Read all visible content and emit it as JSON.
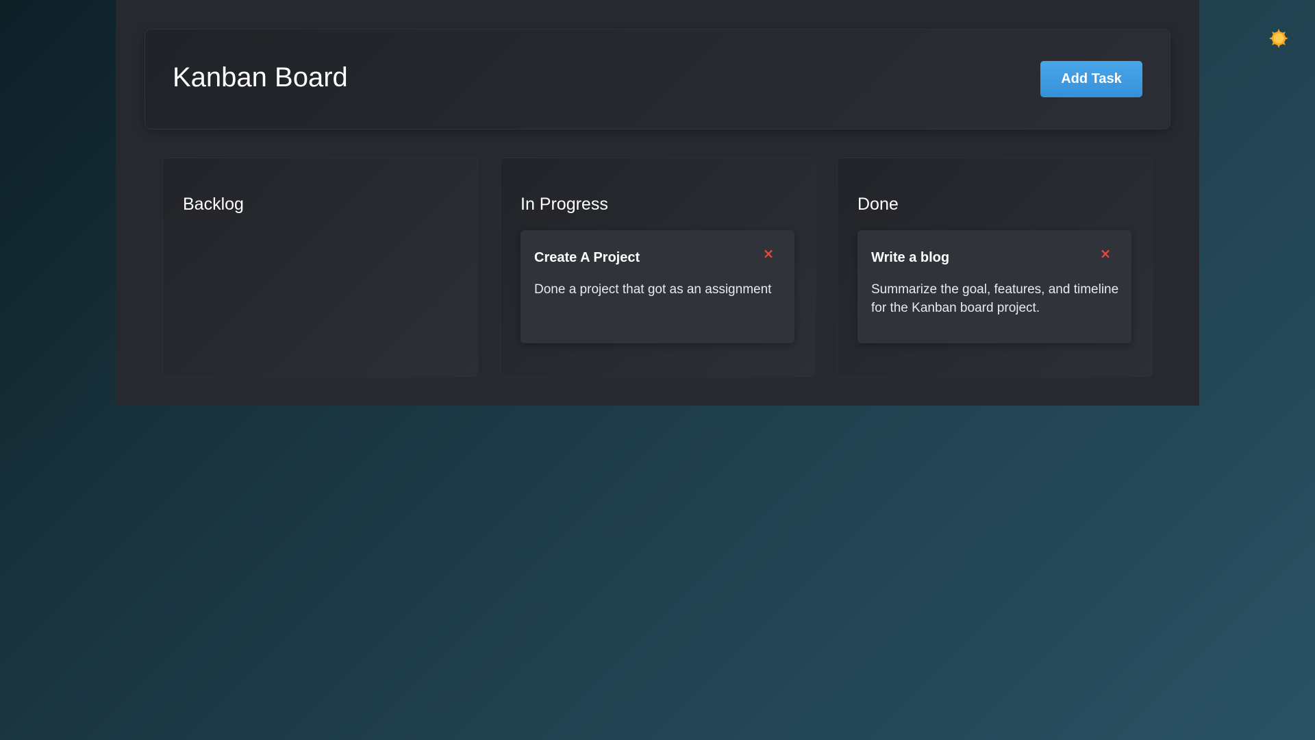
{
  "header": {
    "title": "Kanban Board",
    "add_task_label": "Add Task"
  },
  "theme": {
    "icon": "sun-icon",
    "accent": "#f5a623"
  },
  "colors": {
    "primary_button": "#3d9be0",
    "delete": "#e5453a"
  },
  "columns": [
    {
      "title": "Backlog",
      "tasks": []
    },
    {
      "title": "In Progress",
      "tasks": [
        {
          "title": "Create A Project",
          "description": "Done a project that got as an assignment",
          "delete_icon": "×"
        }
      ]
    },
    {
      "title": "Done",
      "tasks": [
        {
          "title": "Write a blog",
          "description": "Summarize the goal, features, and timeline for the Kanban board project.",
          "delete_icon": "×"
        }
      ]
    }
  ]
}
